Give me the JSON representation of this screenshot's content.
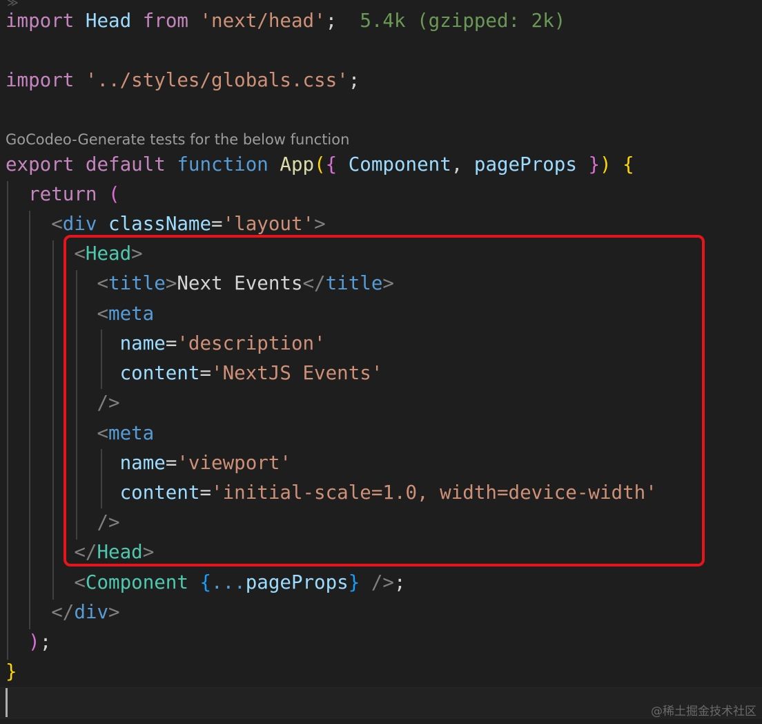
{
  "code": {
    "line1": {
      "kw_import": "import",
      "name": "Head",
      "kw_from": "from",
      "module": "'next/head'",
      "semi": ";",
      "size_hint": "5.4k (gzipped: 2k)"
    },
    "line2": {
      "kw_import": "import",
      "module": "'../styles/globals.css'",
      "semi": ";"
    },
    "codelens": "GoCodeo-Generate tests for the below function",
    "line3": {
      "kw_export": "export",
      "kw_default": "default",
      "kw_function": "function",
      "fn_name": "App",
      "open_paren": "(",
      "open_brace": "{",
      "param1": "Component",
      "comma": ",",
      "param2": "pageProps",
      "close_brace": "}",
      "close_paren": ")",
      "body_brace": "{"
    },
    "line4": {
      "kw_return": "return",
      "paren": "("
    },
    "line5": {
      "lt": "<",
      "tag": "div",
      "attr": "className",
      "eq": "=",
      "value": "'layout'",
      "gt": ">"
    },
    "line6": {
      "lt": "<",
      "tag": "Head",
      "gt": ">"
    },
    "line7": {
      "lt": "<",
      "tag_open": "title",
      "gt": ">",
      "text": "Next Events",
      "lt_close": "</",
      "tag_close": "title",
      "gt_close": ">"
    },
    "line8": {
      "lt": "<",
      "tag": "meta"
    },
    "line9": {
      "attr": "name",
      "eq": "=",
      "value": "'description'"
    },
    "line10": {
      "attr": "content",
      "eq": "=",
      "value": "'NextJS Events'"
    },
    "line11": {
      "selfclose": "/>"
    },
    "line12": {
      "lt": "<",
      "tag": "meta"
    },
    "line13": {
      "attr": "name",
      "eq": "=",
      "value": "'viewport'"
    },
    "line14": {
      "attr": "content",
      "eq": "=",
      "value": "'initial-scale=1.0, width=device-width'"
    },
    "line15": {
      "selfclose": "/>"
    },
    "line16": {
      "lt": "</",
      "tag": "Head",
      "gt": ">"
    },
    "line17": {
      "lt": "<",
      "tag": "Component",
      "open_brace": "{",
      "spread": "...",
      "prop": "pageProps",
      "close_brace": "}",
      "selfclose": "/>",
      "semi": ";"
    },
    "line18": {
      "lt": "</",
      "tag": "div",
      "gt": ">"
    },
    "line19": {
      "paren": ")",
      "semi": ";"
    },
    "line20": {
      "brace": "}"
    }
  },
  "watermark": "@稀土掘金技术社区",
  "colors": {
    "background": "#1e1e1e",
    "highlight_box": "#e8141d"
  }
}
